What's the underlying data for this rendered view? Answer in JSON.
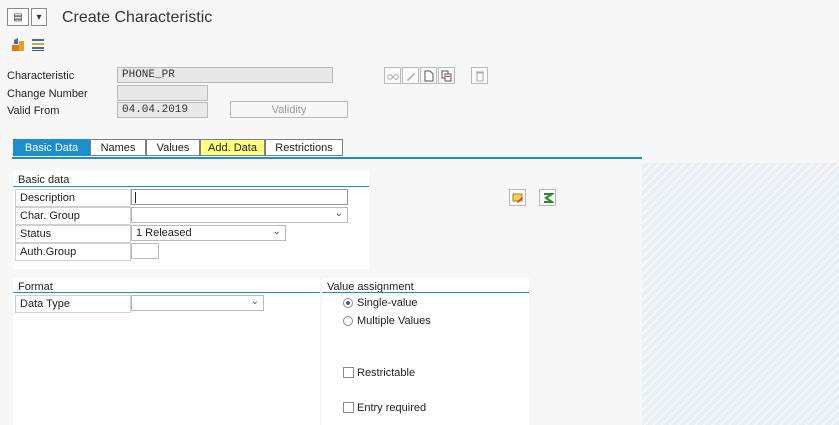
{
  "window": {
    "title": "Create Characteristic",
    "menu_icon_glyph": "▤",
    "dropdown_glyph": "▾"
  },
  "header": {
    "characteristic_label": "Characteristic",
    "characteristic_value": "PHONE_PR",
    "change_number_label": "Change Number",
    "change_number_value": "",
    "valid_from_label": "Valid From",
    "valid_from_value": "04.04.2019",
    "validity_button": "Validity"
  },
  "tabs": [
    {
      "label": "Basic Data"
    },
    {
      "label": "Names"
    },
    {
      "label": "Values"
    },
    {
      "label": "Add. Data"
    },
    {
      "label": "Restrictions"
    }
  ],
  "basic_data": {
    "group_title": "Basic data",
    "description_label": "Description",
    "description_value": "",
    "char_group_label": "Char. Group",
    "char_group_value": "",
    "status_label": "Status",
    "status_value": "1 Released",
    "auth_group_label": "Auth.Group",
    "auth_group_value": ""
  },
  "format": {
    "group_title": "Format",
    "data_type_label": "Data Type",
    "data_type_value": ""
  },
  "value_assignment": {
    "group_title": "Value assignment",
    "single_value_label": "Single-value",
    "multiple_values_label": "Multiple Values",
    "restrictable_label": "Restrictable",
    "entry_required_label": "Entry required",
    "selected": "single"
  },
  "colors": {
    "accent": "#1c8ecf",
    "highlight_tab": "#ffff80"
  }
}
